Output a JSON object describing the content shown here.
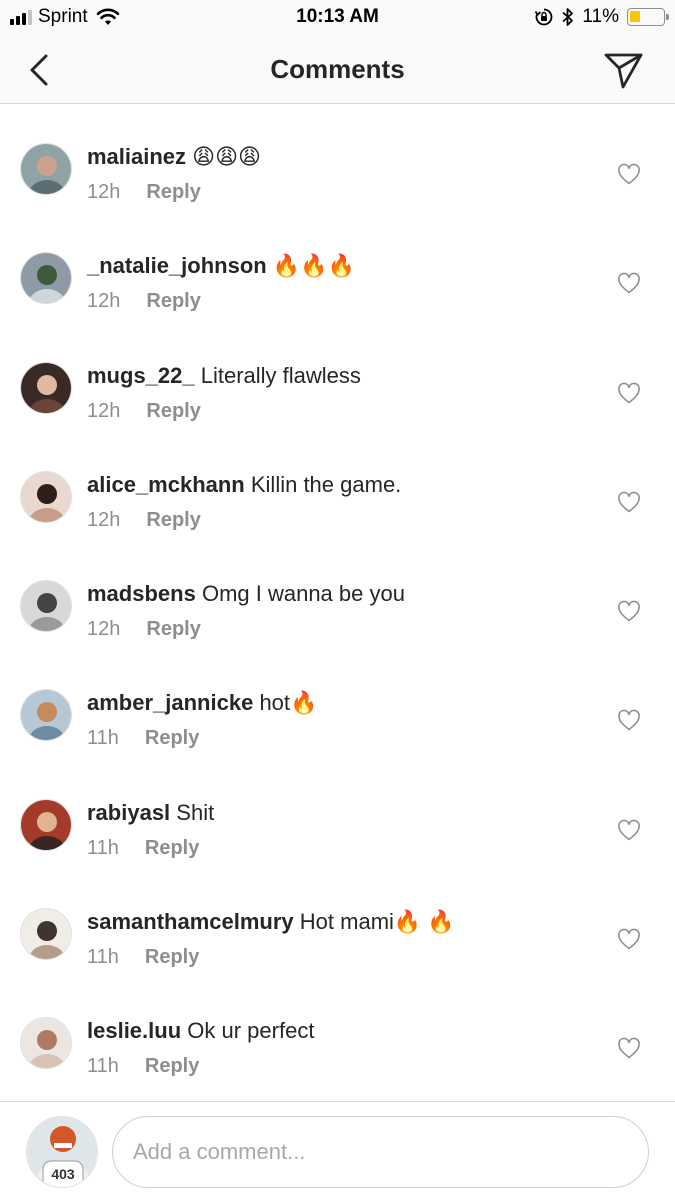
{
  "status_bar": {
    "carrier": "Sprint",
    "time": "10:13 AM",
    "battery_percent": "11%",
    "battery_level": 0.11,
    "icons": [
      "cellular-signal-icon",
      "wifi-icon",
      "orientation-lock-icon",
      "bluetooth-icon",
      "battery-icon"
    ]
  },
  "nav": {
    "title": "Comments",
    "back_icon": "chevron-left-icon",
    "send_icon": "paper-plane-icon"
  },
  "comments": [
    {
      "username": "maliainez",
      "text": "😩😩😩",
      "time": "12h",
      "reply": "Reply"
    },
    {
      "username": "_natalie_johnson",
      "text": "🔥🔥🔥",
      "time": "12h",
      "reply": "Reply"
    },
    {
      "username": "mugs_22_",
      "text": "Literally flawless",
      "time": "12h",
      "reply": "Reply"
    },
    {
      "username": "alice_mckhann",
      "text": "Killin the game.",
      "time": "12h",
      "reply": "Reply"
    },
    {
      "username": "madsbens",
      "text": "Omg I wanna be you",
      "time": "12h",
      "reply": "Reply"
    },
    {
      "username": "amber_jannicke",
      "text": "hot🔥",
      "time": "11h",
      "reply": "Reply"
    },
    {
      "username": "rabiyasl",
      "text": "Shit",
      "time": "11h",
      "reply": "Reply"
    },
    {
      "username": "samanthamcelmury",
      "text": "Hot mami🔥 🔥",
      "time": "11h",
      "reply": "Reply"
    },
    {
      "username": "leslie.luu",
      "text": "Ok ur perfect",
      "time": "11h",
      "reply": "Reply"
    }
  ],
  "footer": {
    "input_placeholder": "Add a comment...",
    "avatar_jersey_number": "403"
  },
  "colors": {
    "text_primary": "#262626",
    "text_secondary": "#8e8e8e",
    "bar_background": "#fafafa",
    "divider": "#dbdbdb",
    "battery_low": "#f7c600"
  }
}
